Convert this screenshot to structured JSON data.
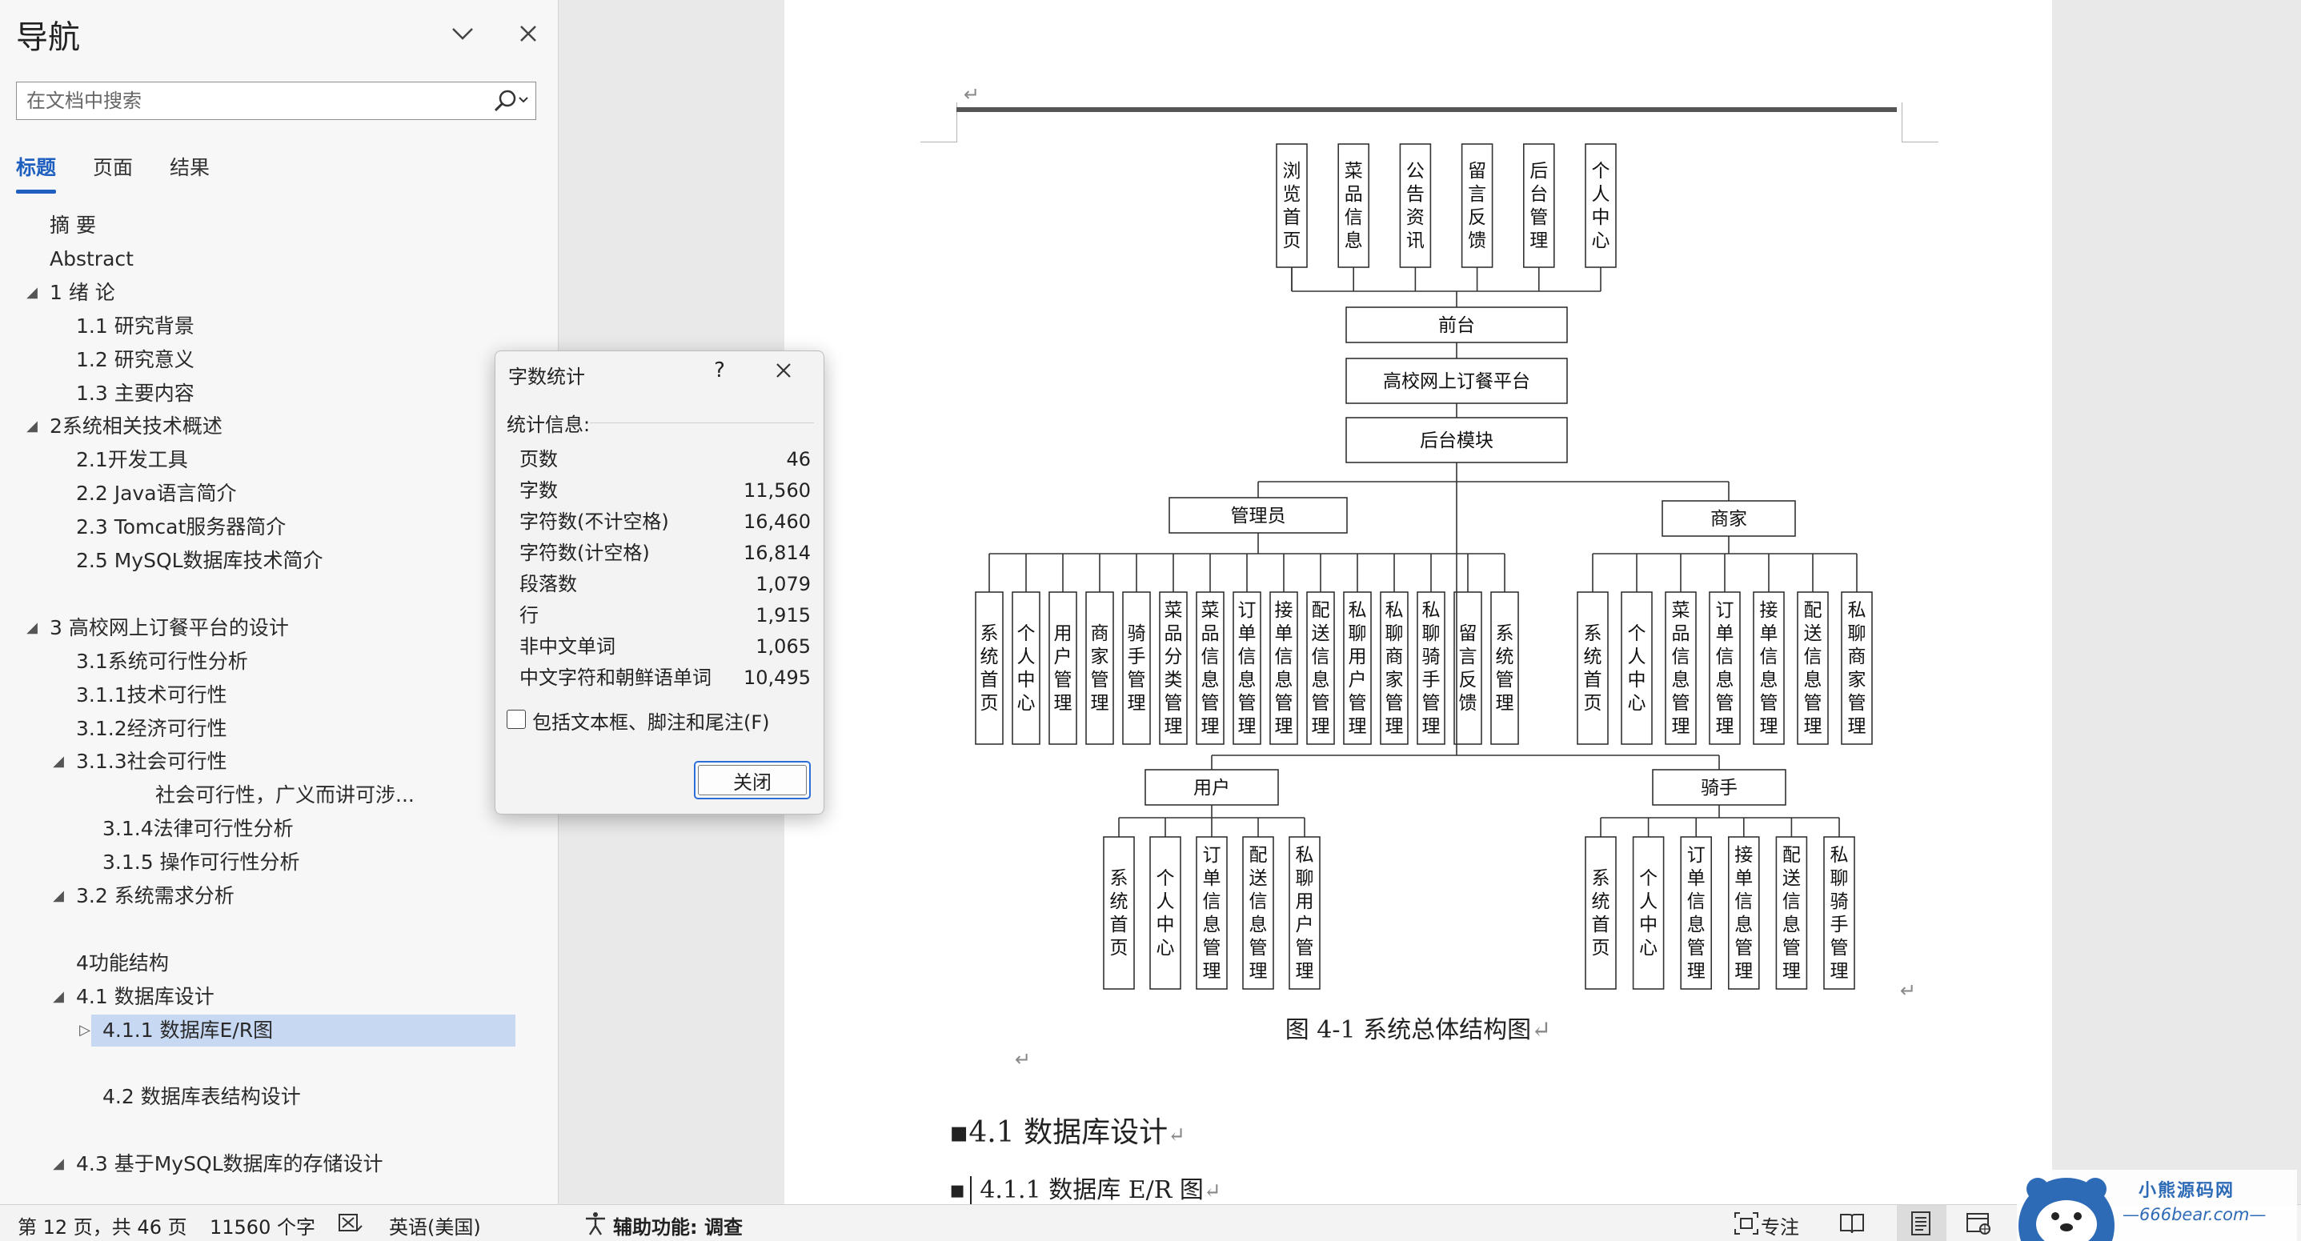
{
  "nav": {
    "title": "导航",
    "search_placeholder": "在文档中搜索",
    "tabs": [
      {
        "label": "标题",
        "active": true
      },
      {
        "label": "页面",
        "active": false
      },
      {
        "label": "结果",
        "active": false
      }
    ],
    "outline": [
      {
        "label": "摘  要",
        "indent": 0,
        "toggle": ""
      },
      {
        "label": "Abstract",
        "indent": 0,
        "toggle": ""
      },
      {
        "label": "1 绪  论",
        "indent": 0,
        "toggle": "◢"
      },
      {
        "label": "1.1 研究背景",
        "indent": 1,
        "toggle": ""
      },
      {
        "label": "1.2 研究意义",
        "indent": 1,
        "toggle": ""
      },
      {
        "label": "1.3 主要内容",
        "indent": 1,
        "toggle": ""
      },
      {
        "label": "2系统相关技术概述",
        "indent": 0,
        "toggle": "◢"
      },
      {
        "label": "2.1开发工具",
        "indent": 1,
        "toggle": ""
      },
      {
        "label": "2.2 Java语言简介",
        "indent": 1,
        "toggle": ""
      },
      {
        "label": "2.3 Tomcat服务器简介",
        "indent": 1,
        "toggle": ""
      },
      {
        "label": "2.5 MySQL数据库技术简介",
        "indent": 1,
        "toggle": ""
      },
      {
        "label": "",
        "indent": 0,
        "toggle": ""
      },
      {
        "label": "3 高校网上订餐平台的设计",
        "indent": 0,
        "toggle": "◢"
      },
      {
        "label": "3.1系统可行性分析",
        "indent": 1,
        "toggle": ""
      },
      {
        "label": "3.1.1技术可行性",
        "indent": 1,
        "toggle": ""
      },
      {
        "label": "3.1.2经济可行性",
        "indent": 1,
        "toggle": ""
      },
      {
        "label": "3.1.3社会可行性",
        "indent": 1,
        "toggle": "◢"
      },
      {
        "label": "社会可行性，广义而讲可涉...",
        "indent": 4,
        "toggle": ""
      },
      {
        "label": "3.1.4法律可行性分析",
        "indent": 2,
        "toggle": ""
      },
      {
        "label": "3.1.5 操作可行性分析",
        "indent": 2,
        "toggle": ""
      },
      {
        "label": "3.2 系统需求分析",
        "indent": 1,
        "toggle": "◢"
      },
      {
        "label": "",
        "indent": 0,
        "toggle": ""
      },
      {
        "label": "4功能结构",
        "indent": 1,
        "toggle": ""
      },
      {
        "label": "4.1 数据库设计",
        "indent": 1,
        "toggle": "◢"
      },
      {
        "label": "4.1.1 数据库E/R图",
        "indent": 2,
        "toggle": "▷",
        "selected": true
      },
      {
        "label": "",
        "indent": 0,
        "toggle": ""
      },
      {
        "label": "4.2 数据库表结构设计",
        "indent": 2,
        "toggle": ""
      },
      {
        "label": "",
        "indent": 0,
        "toggle": ""
      },
      {
        "label": "4.3 基于MySQL数据库的存储设计",
        "indent": 1,
        "toggle": "◢"
      }
    ]
  },
  "dialog": {
    "title": "字数统计",
    "help": "?",
    "section": "统计信息:",
    "stats": [
      {
        "label": "页数",
        "value": "46"
      },
      {
        "label": "字数",
        "value": "11,560"
      },
      {
        "label": "字符数(不计空格)",
        "value": "16,460"
      },
      {
        "label": "字符数(计空格)",
        "value": "16,814"
      },
      {
        "label": "段落数",
        "value": "1,079"
      },
      {
        "label": "行",
        "value": "1,915"
      },
      {
        "label": "非中文单词",
        "value": "1,065"
      },
      {
        "label": "中文字符和朝鲜语单词",
        "value": "10,495"
      }
    ],
    "checkbox_label": "包括文本框、脚注和尾注(F)",
    "close_label": "关闭"
  },
  "document": {
    "diagram": {
      "top_items": [
        "浏览首页",
        "菜品信息",
        "公告资讯",
        "留言反馈",
        "后台管理",
        "个人中心"
      ],
      "frontend": "前台",
      "platform": "高校网上订餐平台",
      "backend": "后台模块",
      "admin": {
        "label": "管理员",
        "items": [
          "系统首页",
          "个人中心",
          "用户管理",
          "商家管理",
          "骑手管理",
          "菜品分类管理",
          "菜品信息管理",
          "订单信息管理",
          "接单信息管理",
          "配送信息管理",
          "私聊用户管理",
          "私聊商家管理",
          "私聊骑手管理",
          "留言反馈",
          "系统管理"
        ]
      },
      "merchant": {
        "label": "商家",
        "items": [
          "系统首页",
          "个人中心",
          "菜品信息管理",
          "订单信息管理",
          "接单信息管理",
          "配送信息管理",
          "私聊商家管理"
        ]
      },
      "user": {
        "label": "用户",
        "items": [
          "系统首页",
          "个人中心",
          "订单信息管理",
          "配送信息管理",
          "私聊用户管理"
        ]
      },
      "rider": {
        "label": "骑手",
        "items": [
          "系统首页",
          "个人中心",
          "订单信息管理",
          "接单信息管理",
          "配送信息管理",
          "私聊骑手管理"
        ]
      }
    },
    "caption": "图 4-1  系统总体结构图",
    "heading1": "4.1  数据库设计",
    "heading2": "4.1.1  数据库 E/R 图",
    "para_mark": "↵"
  },
  "statusbar": {
    "page_info": "第 12 页，共 46 页",
    "word_count": "11560 个字",
    "language": "英语(美国)",
    "accessibility": "辅助功能: 调查",
    "focus": "专注"
  },
  "watermark": {
    "title": "小熊源码网",
    "url": "—666bear.com—"
  }
}
